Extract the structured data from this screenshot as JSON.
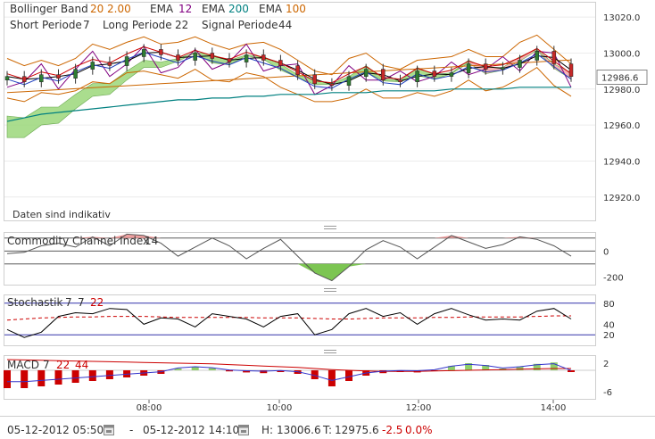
{
  "legend": {
    "bollinger_label": "Bollinger Band",
    "bollinger_p1": "20",
    "bollinger_p2": "2.00",
    "ema_label_1": "EMA",
    "ema_val_1": "12",
    "ema_label_2": "EMA",
    "ema_val_2": "200",
    "ema_label_3": "EMA",
    "ema_val_3": "100",
    "short_label": "Short Periode",
    "short_val": "7",
    "long_label": "Long Periode",
    "long_val": "22",
    "signal_label": "Signal Periode",
    "signal_val": "44"
  },
  "notice": "Daten sind indikativ",
  "indicators": {
    "cci_name": "Commodity Channel Index",
    "cci_period": "14",
    "stoch_name": "Stochastik",
    "stoch_p1": "7",
    "stoch_p2": "7",
    "stoch_p3": "22",
    "macd_name": "MACD",
    "macd_p1": "7",
    "macd_p2": "22",
    "macd_p3": "44"
  },
  "footer": {
    "start": "05-12-2012 05:50",
    "separator": "-",
    "end": "05-12-2012 14:10",
    "high_label": "H:",
    "high": "13006.6",
    "low_label": "T:",
    "low": "12975.6",
    "change": "-2.5",
    "change_pct": "0.0%"
  },
  "colors": {
    "bollinger": "#cc6600",
    "ema12": "#800080",
    "ema200": "#008080",
    "ema100": "#cc6600",
    "cloud_green": "#9bd77a",
    "cloud_red": "#f4a7a7",
    "candle_up": "#2e7d32",
    "candle_down": "#c62828",
    "macd_bar": "#cc0000",
    "change": "#cc0000"
  },
  "chart_data": [
    {
      "type": "line",
      "title": "",
      "x_ticks": [
        "08:00",
        "10:00",
        "12:00",
        "14:00"
      ],
      "y_ticks": [
        13020.0,
        13000.0,
        12980.0,
        12960.0,
        12940.0,
        12920.0
      ],
      "ylim": [
        12907,
        13028
      ],
      "last_value": "12986.6",
      "series": [
        {
          "name": "Close",
          "values": [
            12987,
            12984,
            12988,
            12986,
            12991,
            12995,
            12993,
            12998,
            13002,
            12999,
            12996,
            13000,
            12997,
            12995,
            12999,
            12996,
            12993,
            12988,
            12983,
            12982,
            12987,
            12991,
            12985,
            12984,
            12990,
            12987,
            12989,
            12994,
            12991,
            12992,
            12996,
            13001,
            12994,
            12987
          ]
        },
        {
          "name": "EMA 200",
          "values": [
            12962,
            12964,
            12966,
            12967,
            12968,
            12969,
            12970,
            12971,
            12972,
            12973,
            12974,
            12974,
            12975,
            12975,
            12976,
            12976,
            12977,
            12977,
            12977,
            12978,
            12978,
            12978,
            12979,
            12979,
            12979,
            12979,
            12980,
            12980,
            12980,
            12980,
            12981,
            12981,
            12981,
            12981
          ]
        }
      ]
    },
    {
      "type": "line",
      "title": "Commodity Channel Index",
      "y_ticks": [
        0,
        -200
      ],
      "ylim": [
        -260,
        140
      ],
      "series": [
        {
          "name": "CCI",
          "values": [
            -20,
            -10,
            40,
            60,
            30,
            110,
            40,
            130,
            120,
            60,
            -40,
            30,
            100,
            40,
            -60,
            20,
            90,
            -40,
            -170,
            -230,
            -120,
            10,
            80,
            30,
            -60,
            30,
            120,
            70,
            20,
            50,
            110,
            90,
            40,
            -40
          ]
        }
      ]
    },
    {
      "type": "line",
      "title": "Stochastik",
      "y_ticks": [
        80,
        40,
        20
      ],
      "ylim": [
        0,
        95
      ],
      "series": [
        {
          "name": "%K",
          "values": [
            30,
            15,
            25,
            55,
            62,
            60,
            70,
            68,
            40,
            52,
            50,
            35,
            60,
            55,
            50,
            35,
            55,
            60,
            20,
            30,
            60,
            70,
            55,
            62,
            40,
            60,
            70,
            58,
            48,
            50,
            48,
            65,
            70,
            50
          ]
        },
        {
          "name": "%D",
          "values": [
            48,
            50,
            52,
            53,
            54,
            54,
            55,
            55,
            55,
            54,
            53,
            53,
            53,
            53,
            53,
            52,
            52,
            52,
            51,
            50,
            50,
            51,
            52,
            52,
            52,
            53,
            53,
            54,
            54,
            54,
            54,
            55,
            56,
            56
          ]
        }
      ]
    },
    {
      "type": "bar",
      "title": "MACD",
      "y_ticks": [
        2,
        -6
      ],
      "ylim": [
        -8,
        4
      ],
      "series": [
        {
          "name": "Histogram",
          "values": [
            -5,
            -5,
            -4.5,
            -4,
            -3.5,
            -3,
            -2.5,
            -2,
            -1.5,
            -1,
            0.5,
            1,
            0.6,
            -0.3,
            -0.6,
            -0.8,
            -0.5,
            -1,
            -2.5,
            -4.5,
            -3,
            -1.5,
            -0.8,
            -0.5,
            -0.6,
            -0.2,
            1.2,
            2,
            1.5,
            0.5,
            1,
            1.8,
            2.2,
            -0.5
          ]
        },
        {
          "name": "Signal",
          "values": [
            3,
            2.9,
            2.8,
            2.7,
            2.6,
            2.5,
            2.4,
            2.3,
            2.2,
            2.1,
            2,
            1.9,
            1.8,
            1.6,
            1.4,
            1.2,
            1.0,
            0.8,
            0.5,
            0.2,
            0,
            -0.2,
            -0.3,
            -0.3,
            -0.3,
            -0.2,
            -0.1,
            0,
            0.1,
            0.2,
            0.3,
            0.4,
            0.5,
            0.5
          ]
        }
      ]
    }
  ]
}
